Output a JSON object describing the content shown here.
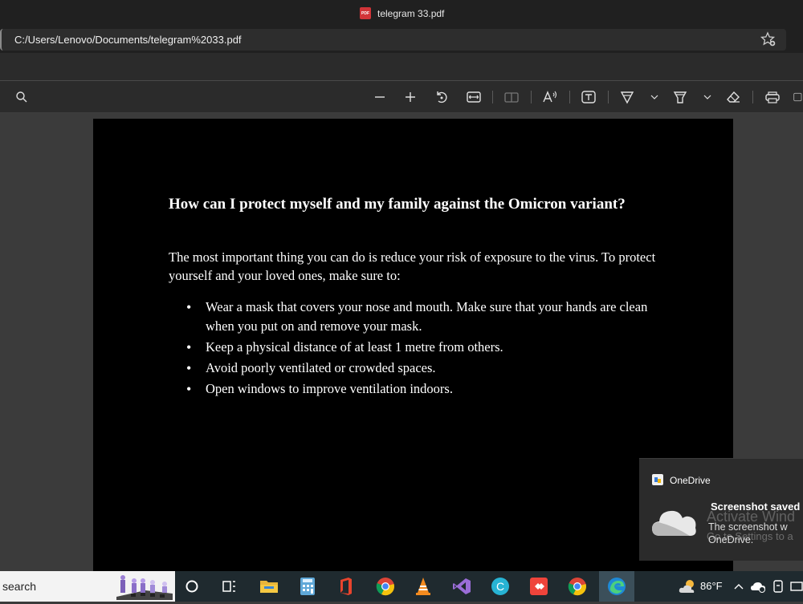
{
  "window": {
    "title": "telegram 33.pdf",
    "pdf_badge": "PDF"
  },
  "address": {
    "url": "C:/Users/Lenovo/Documents/telegram%2033.pdf"
  },
  "toolbar": {
    "icons": [
      "search-icon",
      "zoom-out-icon",
      "zoom-in-icon",
      "rotate-icon",
      "fit-width-icon",
      "page-view-icon",
      "read-aloud-icon",
      "text-icon",
      "draw-icon",
      "highlight-icon",
      "erase-icon",
      "print-icon"
    ]
  },
  "document": {
    "heading": "How can I protect myself and my family against the Omicron variant?",
    "paragraph": "The most important thing you can do is reduce your risk of exposure to the virus. To protect yourself and your loved ones, make sure to:",
    "bullets": [
      "Wear a mask that covers your nose and mouth. Make sure that your hands are clean when you put on and remove your mask.",
      "Keep a physical distance of at least 1 metre from others.",
      "Avoid poorly ventilated or crowded spaces.",
      "Open windows to improve ventilation indoors."
    ]
  },
  "toast": {
    "app": "OneDrive",
    "title": "Screenshot saved",
    "body_line1": "The screenshot w",
    "body_line2": "OneDrive.",
    "watermark_line1": "Activate Wind",
    "watermark_line2": "Go to Settings to a"
  },
  "taskbar": {
    "search_text": "search",
    "temperature": "86°F"
  },
  "colors": {
    "page_bg": "#000000",
    "chrome_bg": "#2b2b2b",
    "taskbar_bg": "#1f2a2f"
  }
}
